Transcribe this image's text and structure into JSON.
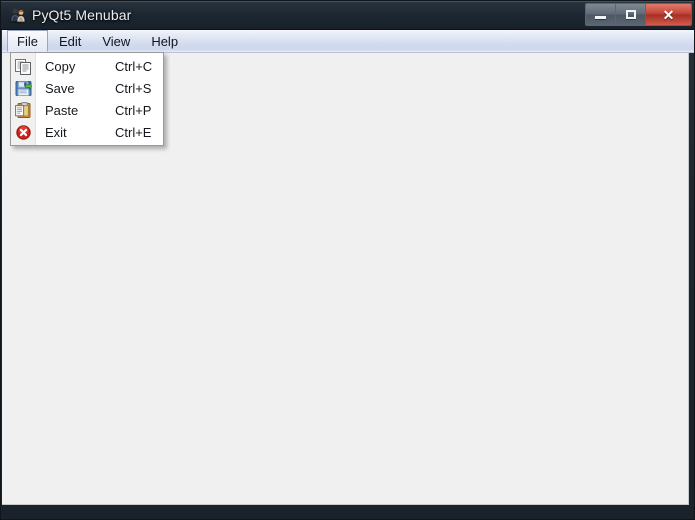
{
  "window": {
    "title": "PyQt5 Menubar",
    "icon": "users-app-icon",
    "frame_color": "#1d2630",
    "client_color": "#f0f0f0"
  },
  "titlebar_buttons": [
    {
      "name": "minimize",
      "label": "—",
      "tooltip": "Minimize"
    },
    {
      "name": "maximize",
      "label": "□",
      "tooltip": "Maximize"
    },
    {
      "name": "close",
      "label": "✕",
      "tooltip": "Close",
      "color": "#c4453a"
    }
  ],
  "menubar": {
    "items": [
      {
        "label": "File",
        "open": true
      },
      {
        "label": "Edit",
        "open": false
      },
      {
        "label": "View",
        "open": false
      },
      {
        "label": "Help",
        "open": false
      }
    ]
  },
  "dropdown": {
    "owner": "File",
    "items": [
      {
        "label": "Copy",
        "shortcut": "Ctrl+C",
        "icon": "copy-icon"
      },
      {
        "label": "Save",
        "shortcut": "Ctrl+S",
        "icon": "save-icon"
      },
      {
        "label": "Paste",
        "shortcut": "Ctrl+P",
        "icon": "paste-icon"
      },
      {
        "label": "Exit",
        "shortcut": "Ctrl+E",
        "icon": "exit-icon"
      }
    ]
  }
}
